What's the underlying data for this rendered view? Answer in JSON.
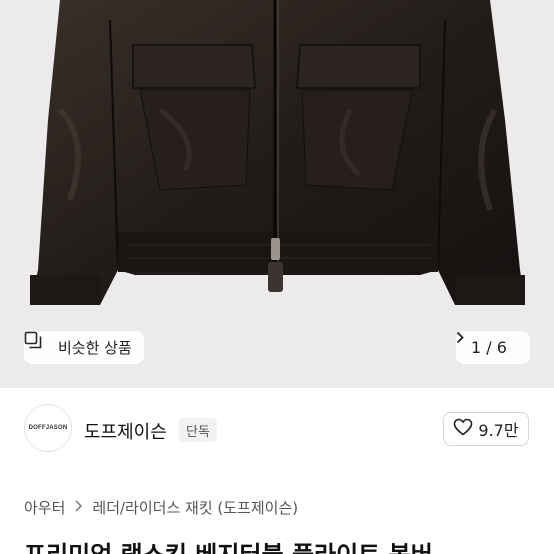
{
  "gallery": {
    "similar_label": "비슷한 상품",
    "similar_icon": "similar-items-icon",
    "counter_text": "1 / 6",
    "next_icon": "chevron-right-icon"
  },
  "seller": {
    "logo_text": "DOFFJASON",
    "name": "도프제이슨",
    "badge": "단독",
    "likes": "9.7만",
    "like_icon": "heart-outline-icon"
  },
  "breadcrumb": {
    "items": [
      "아우터",
      "레더/라이더스 재킷 (도프제이슨)"
    ],
    "separator_icon": "chevron-right-icon"
  },
  "product": {
    "title": "프리미엄 램스킨 베지터블 플라이트 봄버"
  },
  "colors": {
    "image_bg": "#eceaea",
    "jacket": "#241e1a",
    "badge_bg": "#f1f1f1"
  }
}
